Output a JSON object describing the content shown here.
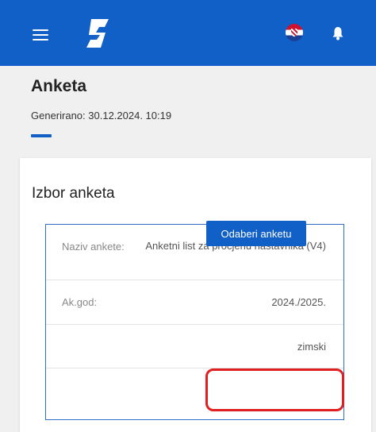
{
  "header": {
    "menu_icon": "hamburger-menu-icon",
    "logo_icon": "app-logo",
    "language_icon": "croatian-flag-icon",
    "notifications_icon": "bell-icon",
    "brand_color": "#1060c8"
  },
  "page": {
    "title": "Anketa",
    "generated": "Generirano: 30.12.2024. 10:19"
  },
  "card": {
    "title": "Izbor anketa",
    "rows": [
      {
        "label": "Naziv ankete:",
        "value": "Anketni list za procjenu nastavnika (V4)"
      },
      {
        "label": "Ak.god:",
        "value": "2024./2025."
      },
      {
        "label": "",
        "value": "zimski"
      }
    ],
    "action_label": "Odaberi anketu"
  },
  "annotation": {
    "highlight_color": "#e02020"
  }
}
